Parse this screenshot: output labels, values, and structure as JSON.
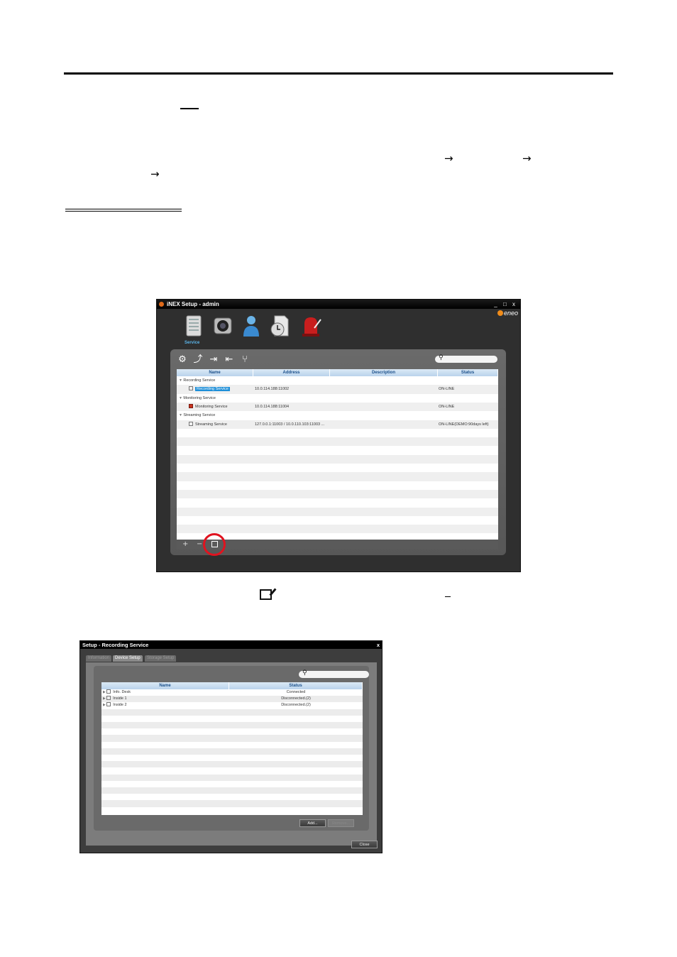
{
  "window1": {
    "title": "iNEX Setup - admin",
    "logo": "eneo",
    "window_buttons": "_ □ x",
    "nav_label": "Service",
    "search_placeholder": "",
    "columns": [
      "Name",
      "Address",
      "Description",
      "Status"
    ],
    "rows": [
      {
        "type": "group",
        "name": "Recording Service",
        "address": "",
        "status": ""
      },
      {
        "type": "item",
        "name": "Recording Service",
        "address": "10.0.114.188:11002",
        "status": "ON-LINE",
        "selected": true
      },
      {
        "type": "group",
        "name": "Monitoring Service",
        "address": "",
        "status": ""
      },
      {
        "type": "item",
        "name": "Monitoring Service",
        "address": "10.0.114.188:11004",
        "status": "ON-LINE"
      },
      {
        "type": "group",
        "name": "Streaming Service",
        "address": "",
        "status": ""
      },
      {
        "type": "item",
        "name": "Streaming Service",
        "address": "127.0.0.1:11003  /  10.0.110.103:11003  ...",
        "status": "ON-LINE(DEMO:90days left)"
      }
    ],
    "bottom_buttons": [
      "+",
      "−"
    ],
    "highlight_color": "#e0131f"
  },
  "window2": {
    "title": "Setup - Recording Service",
    "close": "x",
    "tabs": [
      "Information",
      "Device Setup",
      "Storage Setup"
    ],
    "active_tab": 1,
    "columns": [
      "Name",
      "Status"
    ],
    "rows": [
      {
        "name": "Info. Desk",
        "status": "Connected"
      },
      {
        "name": "Inside 1",
        "status": "Disconnected.(2)"
      },
      {
        "name": "Inside 2",
        "status": "Disconnected.(2)"
      }
    ],
    "add_label": "Add...",
    "remove_label": "Remove...",
    "close_label": "Close"
  }
}
